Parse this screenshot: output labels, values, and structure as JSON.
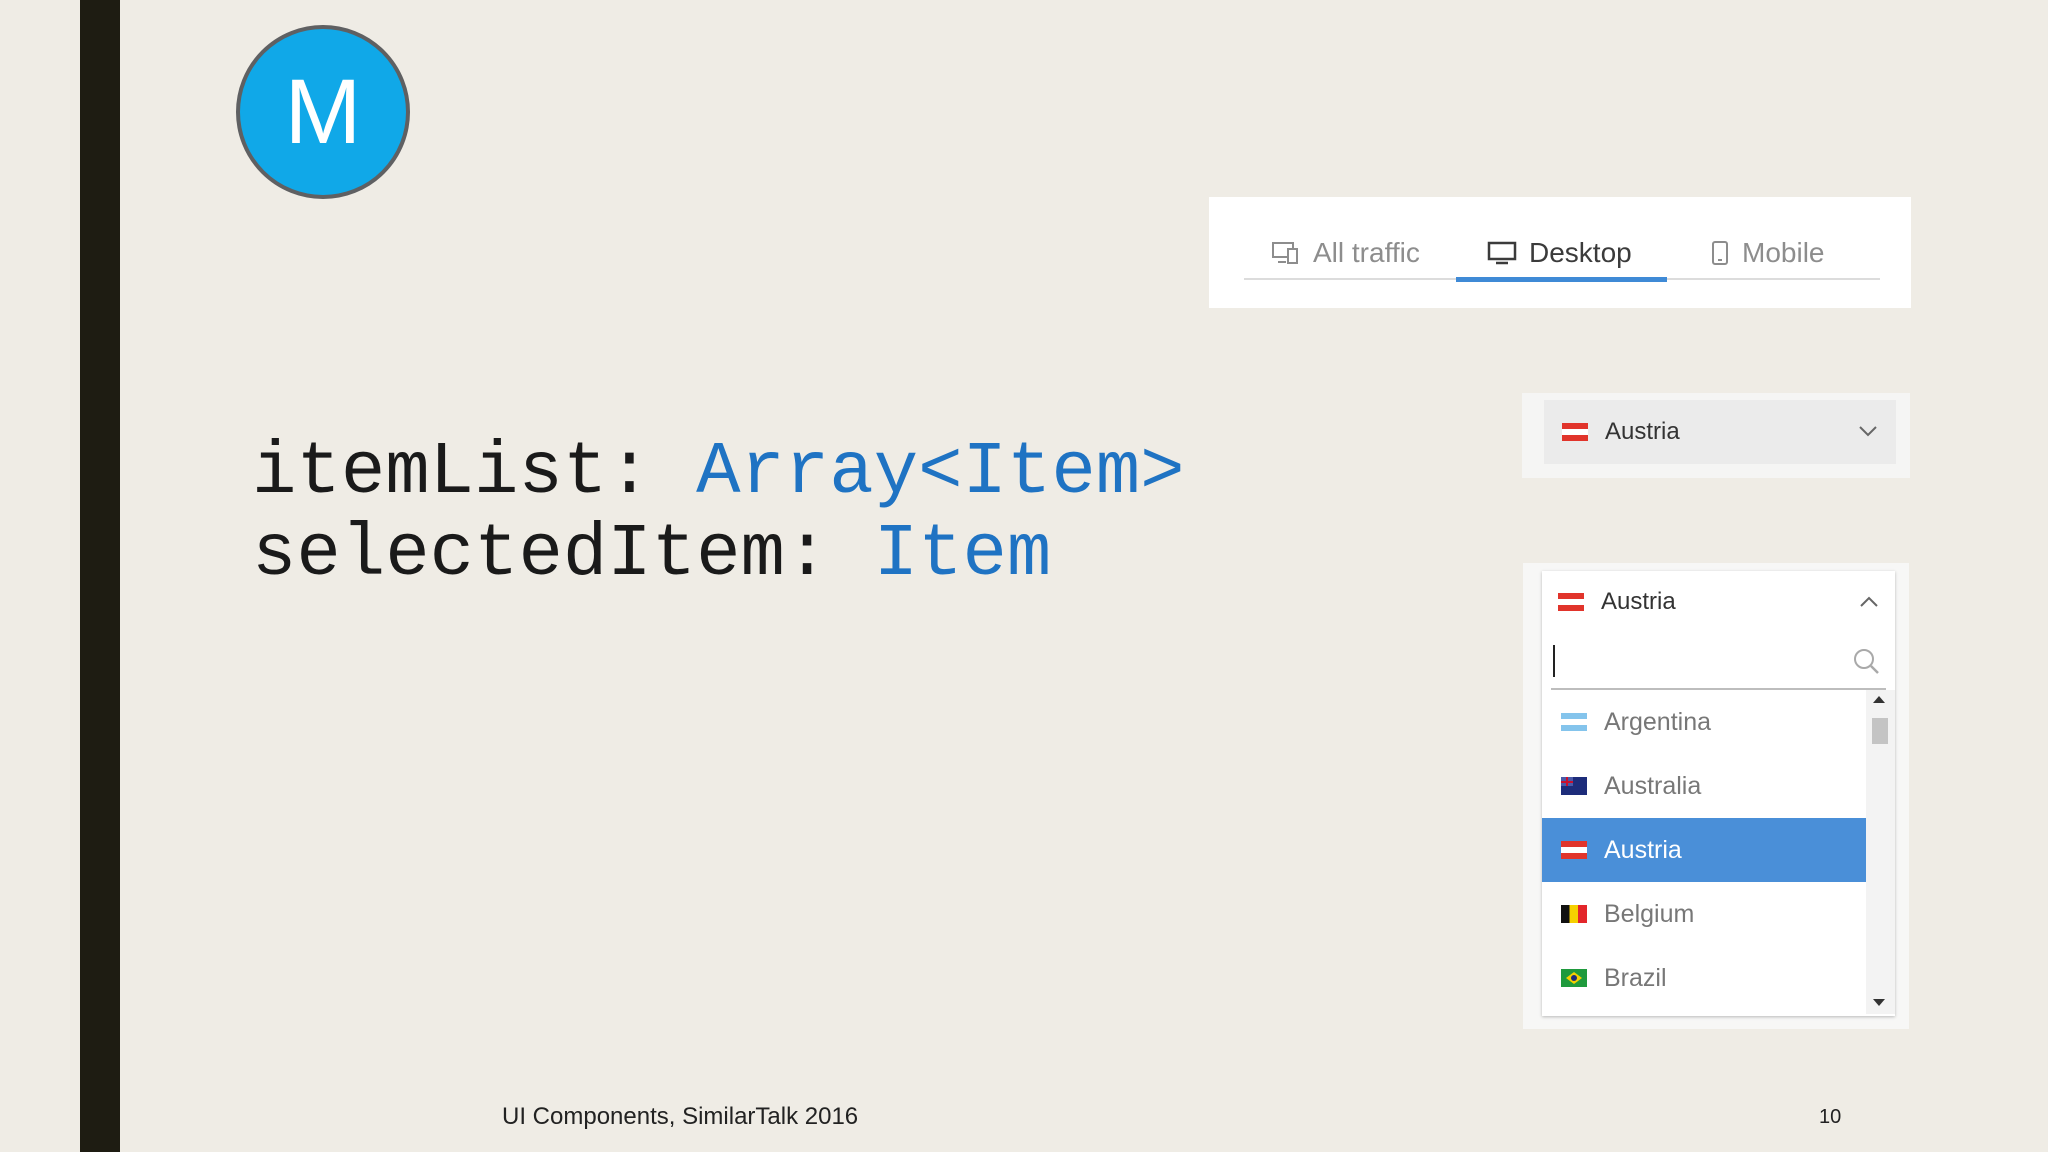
{
  "logo": {
    "letter": "M"
  },
  "code": {
    "line1": {
      "name": "itemList: ",
      "type": "Array<Item>"
    },
    "line2": {
      "name": "selectedItem: ",
      "type": "Item"
    }
  },
  "traffic_tabs": {
    "items": [
      {
        "label": "All traffic",
        "icon": "all-traffic-icon",
        "active": false
      },
      {
        "label": "Desktop",
        "icon": "desktop-icon",
        "active": true
      },
      {
        "label": "Mobile",
        "icon": "mobile-icon",
        "active": false
      }
    ]
  },
  "country_dropdown_closed": {
    "selected": "Austria",
    "selected_flag": "austria-flag-icon"
  },
  "country_dropdown_open": {
    "selected": "Austria",
    "search": {
      "value": "",
      "placeholder": ""
    },
    "options": [
      {
        "label": "Argentina",
        "flag": "argentina-flag-icon"
      },
      {
        "label": "Australia",
        "flag": "australia-flag-icon"
      },
      {
        "label": "Austria",
        "flag": "austria-flag-icon",
        "selected": true
      },
      {
        "label": "Belgium",
        "flag": "belgium-flag-icon"
      },
      {
        "label": "Brazil",
        "flag": "brazil-flag-icon"
      }
    ]
  },
  "footer": {
    "text": "UI Components, SimilarTalk 2016",
    "page_number": "10"
  },
  "colors": {
    "accent": "#4a8fd8",
    "logo": "#10a8e8",
    "code_type": "#1f73c3",
    "background": "#efece5"
  }
}
